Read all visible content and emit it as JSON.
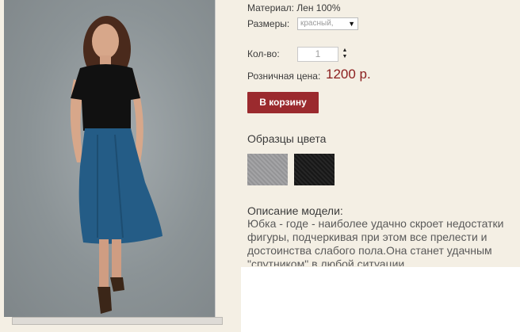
{
  "product": {
    "material_text": "Материал: Лен 100%",
    "sizes_label": "Размеры:",
    "size_selected": "красный, ",
    "qty_label": "Кол-во:",
    "qty_value": "1",
    "price_label": "Розничная цена:",
    "price_value": "1200 р.",
    "cart_button": "В корзину",
    "swatches_title": "Образцы цвета",
    "description_title": "Описание модели:",
    "description_text": "Юбка - годе - наиболее удачно скроет недостатки фигуры, подчеркивая при этом все прелести и достоинства слабого пола.Она станет удачным \"спутником\" в любой ситуации"
  },
  "colors": {
    "accent": "#9b2a2e",
    "price": "#8b1e1e",
    "background": "#f4efe4",
    "swatch_gray": "#9c9c9e",
    "swatch_black": "#1a1a1a"
  },
  "icons": {
    "select_arrow": "chevron-down-icon",
    "spinner": "spin-updown-icon"
  }
}
